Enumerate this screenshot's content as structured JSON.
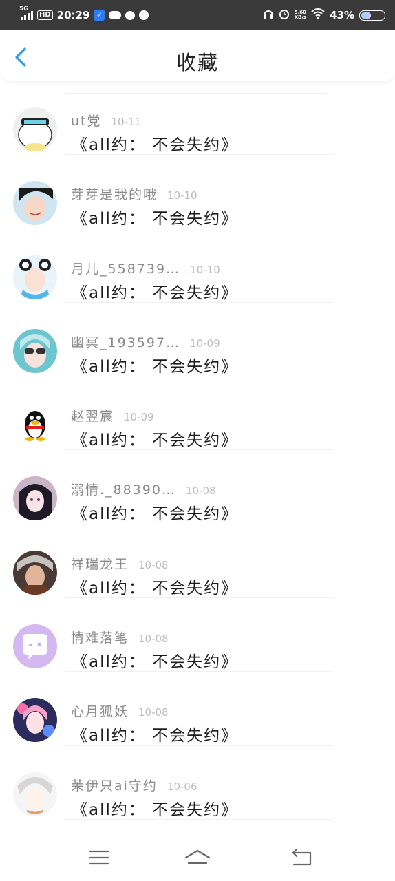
{
  "status_bar": {
    "network": "5G",
    "hd": "HD",
    "time": "20:29",
    "net_speed_value": "5.60",
    "net_speed_unit": "KB/s",
    "battery_percent": "43%",
    "battery_level": 0.43
  },
  "header": {
    "title": "收藏"
  },
  "items": [
    {
      "name": "ut党",
      "date": "10-11",
      "message": "《all约： 不会失约》"
    },
    {
      "name": "芽芽是我的哦",
      "date": "10-10",
      "message": "《all约： 不会失约》"
    },
    {
      "name": "月儿_558739…",
      "date": "10-10",
      "message": "《all约： 不会失约》"
    },
    {
      "name": "幽冥_193597…",
      "date": "10-09",
      "message": "《all约： 不会失约》"
    },
    {
      "name": "赵翌宸",
      "date": "10-09",
      "message": "《all约： 不会失约》"
    },
    {
      "name": "溺情._88390…",
      "date": "10-08",
      "message": "《all约： 不会失约》"
    },
    {
      "name": "祥瑞龙王",
      "date": "10-08",
      "message": "《all约： 不会失约》"
    },
    {
      "name": "情难落笔",
      "date": "10-08",
      "message": "《all约： 不会失约》"
    },
    {
      "name": "心月狐妖",
      "date": "10-08",
      "message": "《all约： 不会失约》"
    },
    {
      "name": "茉伊只ai守约",
      "date": "10-06",
      "message": "《all约： 不会失约》"
    }
  ],
  "colors": {
    "accent": "#2f9be6",
    "status_bar_bg": "#3a3a3a"
  },
  "nav_icons": [
    "menu-icon",
    "home-icon",
    "back-icon"
  ]
}
